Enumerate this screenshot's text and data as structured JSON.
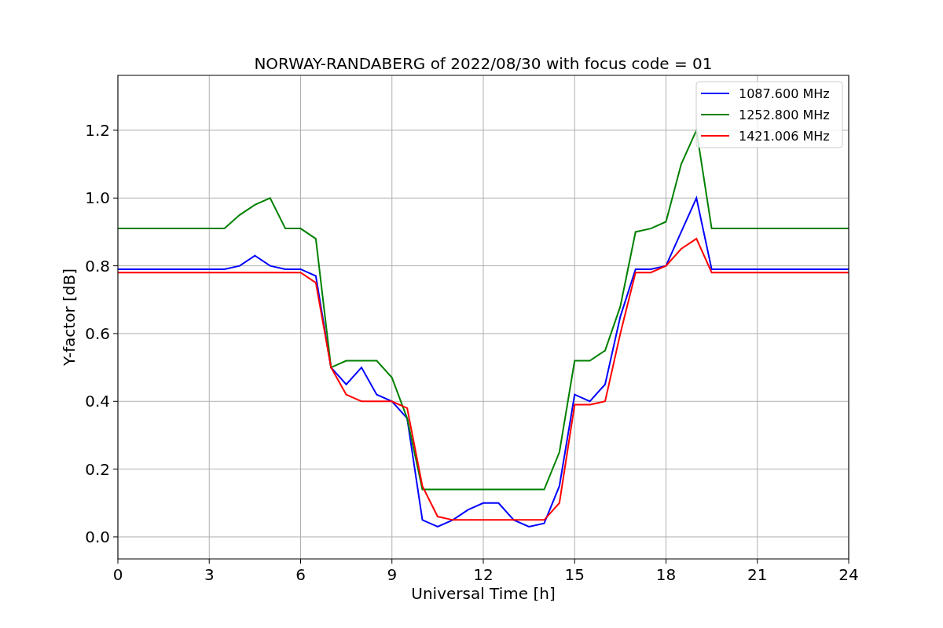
{
  "chart_data": {
    "type": "line",
    "title": "NORWAY-RANDABERG of 2022/08/30 with focus code = 01",
    "xlabel": "Universal Time [h]",
    "ylabel": "Y-factor [dB]",
    "x": [
      0,
      0.5,
      1,
      1.5,
      2,
      2.5,
      3,
      3.5,
      4,
      4.5,
      5,
      5.5,
      6,
      6.5,
      7,
      7.5,
      8,
      8.5,
      9,
      9.5,
      10,
      10.5,
      11,
      11.5,
      12,
      12.5,
      13,
      13.5,
      14,
      14.5,
      15,
      15.5,
      16,
      16.5,
      17,
      17.5,
      18,
      18.5,
      19,
      19.5,
      20,
      20.5,
      21,
      21.5,
      22,
      22.5,
      23,
      23.5,
      24
    ],
    "series": [
      {
        "name": "1087.600 MHz",
        "color": "#0000ff",
        "values": [
          0.79,
          0.79,
          0.79,
          0.79,
          0.79,
          0.79,
          0.79,
          0.79,
          0.8,
          0.83,
          0.8,
          0.79,
          0.79,
          0.77,
          0.5,
          0.45,
          0.5,
          0.42,
          0.4,
          0.35,
          0.05,
          0.03,
          0.05,
          0.08,
          0.1,
          0.1,
          0.05,
          0.03,
          0.04,
          0.15,
          0.42,
          0.4,
          0.45,
          0.65,
          0.79,
          0.79,
          0.8,
          0.9,
          1.0,
          0.79,
          0.79,
          0.79,
          0.79,
          0.79,
          0.79,
          0.79,
          0.79,
          0.79,
          0.79
        ]
      },
      {
        "name": "1252.800 MHz",
        "color": "#008000",
        "values": [
          0.91,
          0.91,
          0.91,
          0.91,
          0.91,
          0.91,
          0.91,
          0.91,
          0.95,
          0.98,
          1.0,
          0.91,
          0.91,
          0.88,
          0.5,
          0.52,
          0.52,
          0.52,
          0.47,
          0.35,
          0.14,
          0.14,
          0.14,
          0.14,
          0.14,
          0.14,
          0.14,
          0.14,
          0.14,
          0.25,
          0.52,
          0.52,
          0.55,
          0.68,
          0.9,
          0.91,
          0.93,
          1.1,
          1.2,
          0.91,
          0.91,
          0.91,
          0.91,
          0.91,
          0.91,
          0.91,
          0.91,
          0.91,
          0.91
        ]
      },
      {
        "name": "1421.006 MHz",
        "color": "#ff0000",
        "values": [
          0.78,
          0.78,
          0.78,
          0.78,
          0.78,
          0.78,
          0.78,
          0.78,
          0.78,
          0.78,
          0.78,
          0.78,
          0.78,
          0.75,
          0.5,
          0.42,
          0.4,
          0.4,
          0.4,
          0.38,
          0.15,
          0.06,
          0.05,
          0.05,
          0.05,
          0.05,
          0.05,
          0.05,
          0.05,
          0.1,
          0.39,
          0.39,
          0.4,
          0.6,
          0.78,
          0.78,
          0.8,
          0.85,
          0.88,
          0.78,
          0.78,
          0.78,
          0.78,
          0.78,
          0.78,
          0.78,
          0.78,
          0.78,
          0.78
        ]
      }
    ],
    "grid": true,
    "legend": true,
    "xlim": [
      0,
      24
    ],
    "ylim": [
      -0.065,
      1.362
    ],
    "xticks": [
      0,
      3,
      6,
      9,
      12,
      15,
      18,
      21,
      24
    ],
    "yticks": [
      {
        "value": 0,
        "label": "0.0"
      },
      {
        "value": 0.2,
        "label": "0.2"
      },
      {
        "value": 0.4,
        "label": "0.4"
      },
      {
        "value": 0.6,
        "label": "0.6"
      },
      {
        "value": 0.8,
        "label": "0.8"
      },
      {
        "value": 1.0,
        "label": "1.0"
      },
      {
        "value": 1.2,
        "label": "1.2"
      }
    ]
  }
}
